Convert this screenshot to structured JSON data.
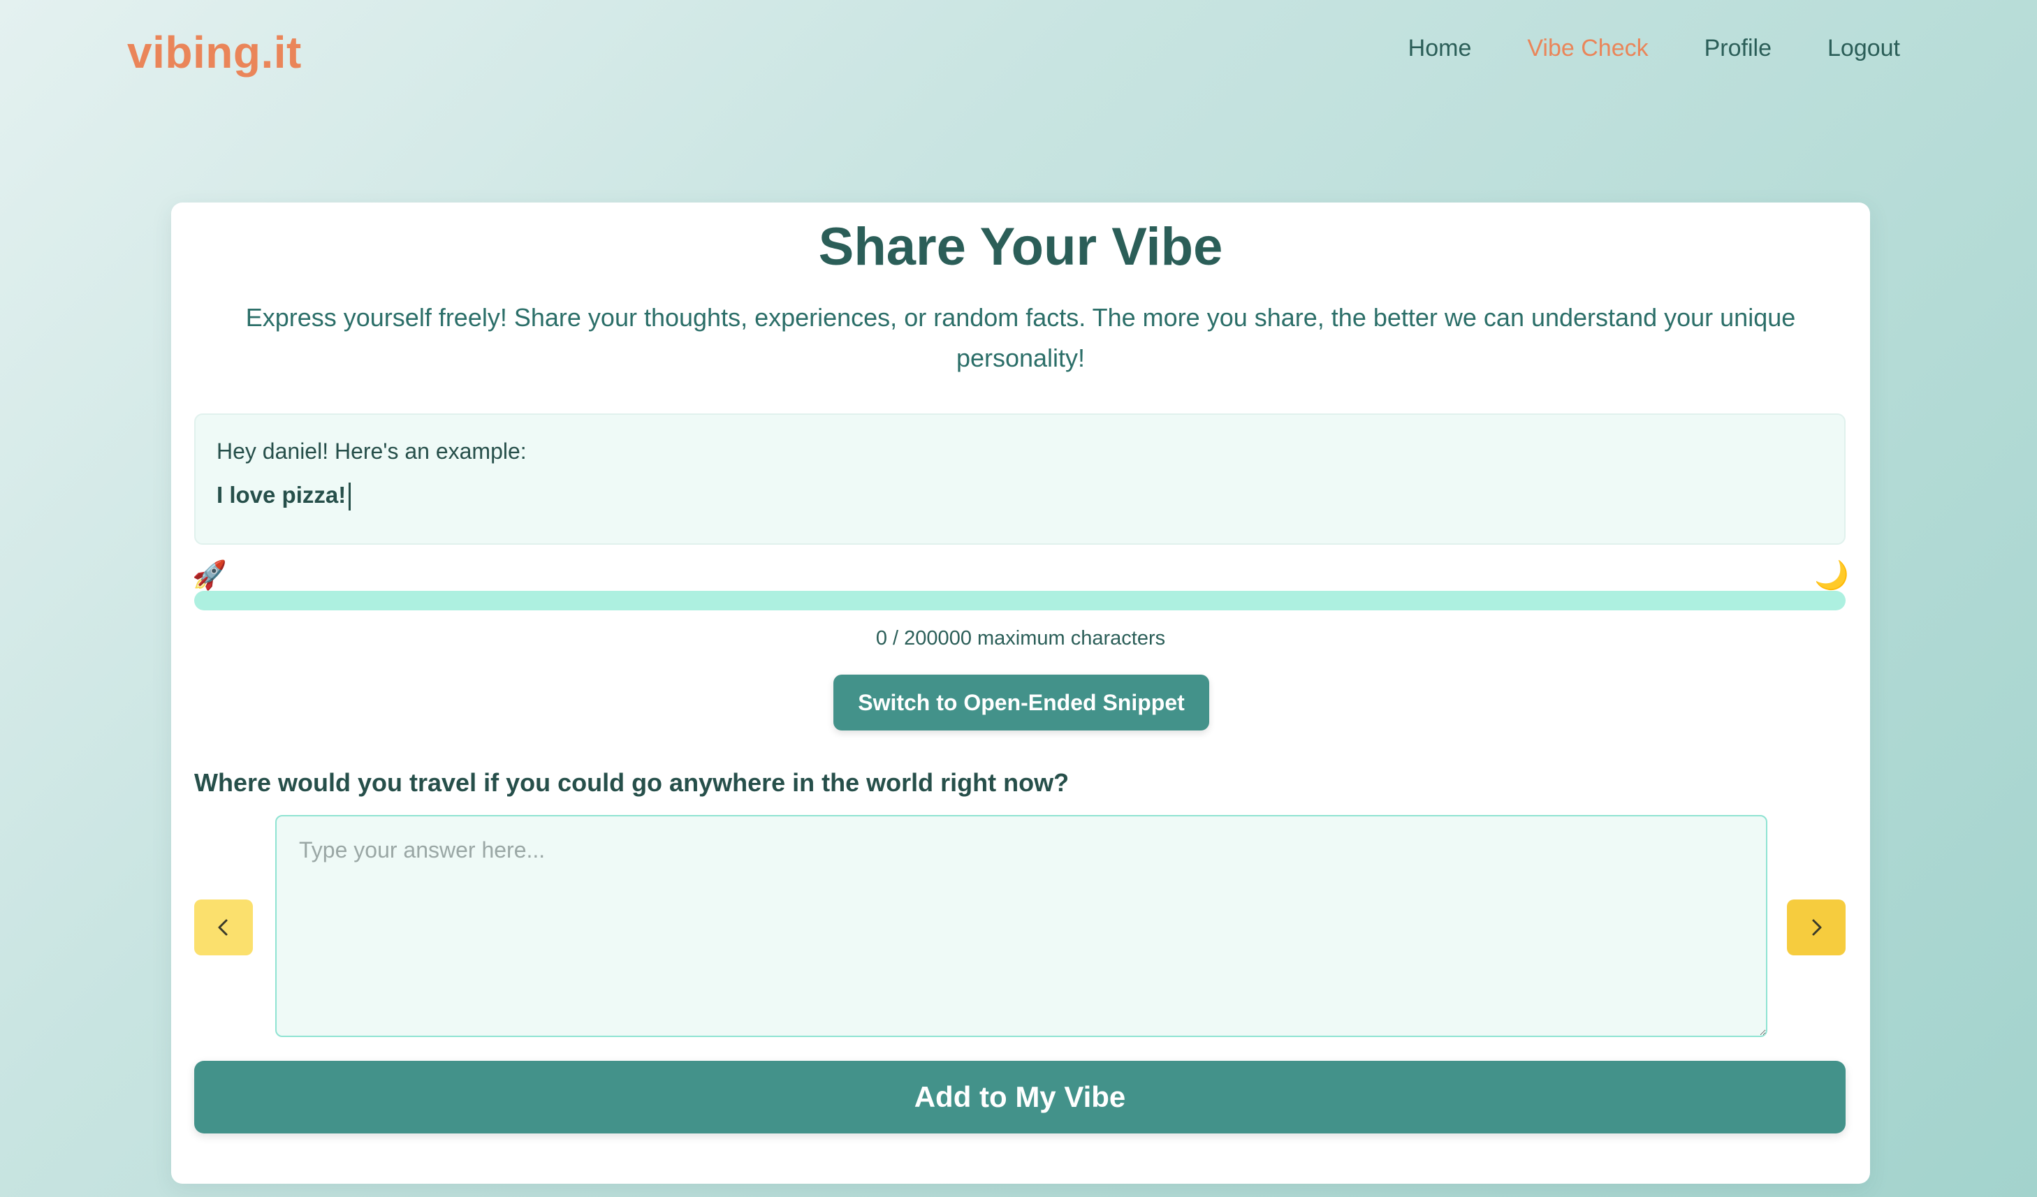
{
  "brand": {
    "logo": "vibing.it"
  },
  "nav": {
    "items": [
      {
        "label": "Home",
        "active": false
      },
      {
        "label": "Vibe Check",
        "active": true
      },
      {
        "label": "Profile",
        "active": false
      },
      {
        "label": "Logout",
        "active": false
      }
    ]
  },
  "main": {
    "title": "Share Your Vibe",
    "subtitle": "Express yourself freely! Share your thoughts, experiences, or random facts. The more you share, the better we can understand your unique personality!",
    "example": {
      "label": "Hey daniel! Here's an example:",
      "text": "I love pizza!"
    },
    "progress": {
      "start_icon": "rocket-icon",
      "end_icon": "moon-icon",
      "start_glyph": "🚀",
      "end_glyph": "🌙",
      "fraction": 0,
      "char_count_text": "0 / 200000 maximum characters"
    },
    "switch_button": "Switch to Open-Ended Snippet",
    "question": "Where would you travel if you could go anywhere in the world right now?",
    "answer": {
      "value": "",
      "placeholder": "Type your answer here..."
    },
    "prev_icon": "chevron-left-icon",
    "next_icon": "chevron-right-icon",
    "add_button": "Add to My Vibe"
  },
  "colors": {
    "accent": "#ea8559",
    "primary": "#43928a",
    "text": "#2b5e58",
    "progress_track": "#adf0e0",
    "arrow_prev": "#fbe06d",
    "arrow_next": "#f6cc3e"
  }
}
